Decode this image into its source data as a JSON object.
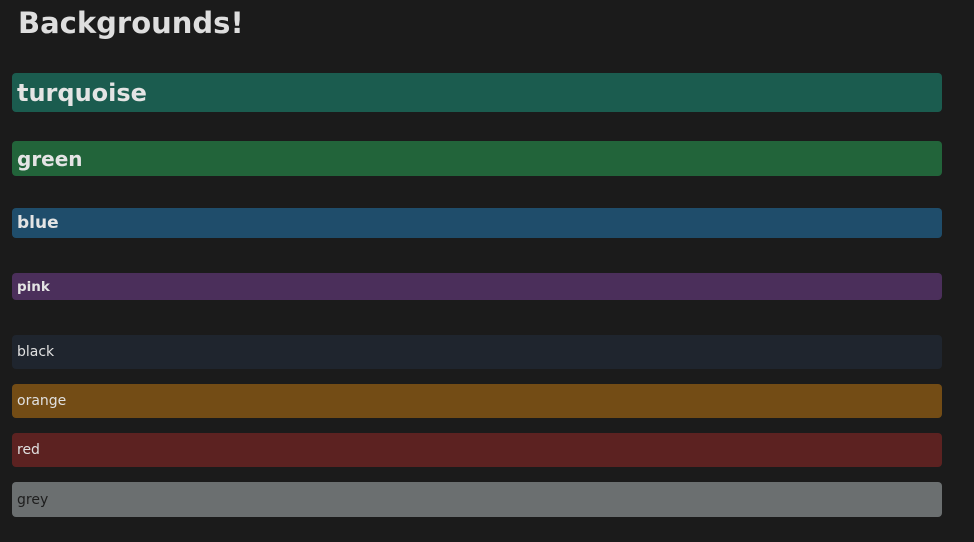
{
  "page": {
    "title": "Backgrounds!"
  },
  "bars": [
    {
      "key": "turquoise",
      "label": "turquoise",
      "color": "#1b5c4f"
    },
    {
      "key": "green",
      "label": "green",
      "color": "#22643a"
    },
    {
      "key": "blue",
      "label": "blue",
      "color": "#1f4d6b"
    },
    {
      "key": "pink",
      "label": "pink",
      "color": "#4b2f5b"
    },
    {
      "key": "black",
      "label": "black",
      "color": "#1f252e"
    },
    {
      "key": "orange",
      "label": "orange",
      "color": "#734c15"
    },
    {
      "key": "red",
      "label": "red",
      "color": "#5c2221"
    },
    {
      "key": "grey",
      "label": "grey",
      "color": "#6b6f70"
    }
  ]
}
